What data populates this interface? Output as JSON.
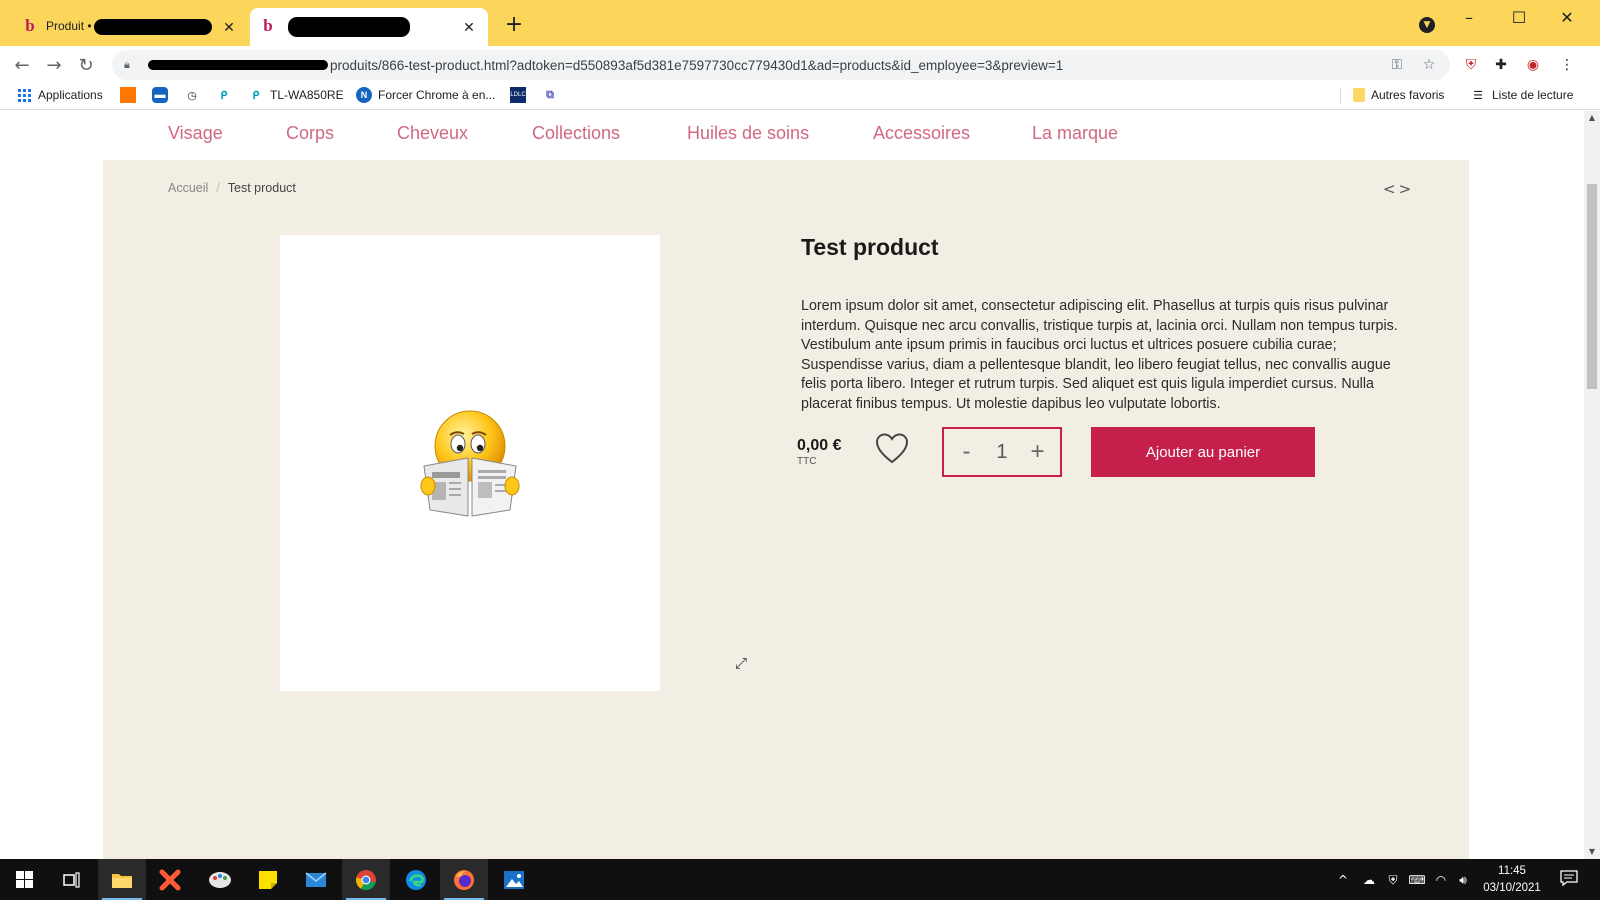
{
  "browser": {
    "tabs": [
      {
        "favicon": "b",
        "title": "Produit •",
        "close": "✕"
      },
      {
        "favicon": "b",
        "title": "",
        "close": "✕"
      }
    ],
    "new_tab": "+",
    "address": {
      "url_visible": "produits/866-test-product.html?adtoken=d550893af5d381e7597730cc779430d1&ad=products&id_employee=3&preview=1"
    },
    "bookmarks": [
      {
        "label": "Applications",
        "icon": "apps-grid-icon"
      },
      {
        "label": "",
        "icon": "orange-icon"
      },
      {
        "label": "",
        "icon": "blue-square-icon"
      },
      {
        "label": "",
        "icon": "clock-icon"
      },
      {
        "label": "",
        "icon": "tplink-icon"
      },
      {
        "label": "TL-WA850RE",
        "icon": "tplink-icon"
      },
      {
        "label": "Forcer Chrome à en...",
        "icon": "n-icon"
      },
      {
        "label": "",
        "icon": "ldlc-icon"
      },
      {
        "label": "",
        "icon": "teams-icon"
      }
    ],
    "other_bookmarks": "Autres favoris",
    "reading_list": "Liste de lecture"
  },
  "site": {
    "nav": [
      "Visage",
      "Corps",
      "Cheveux",
      "Collections",
      "Huiles de soins",
      "Accessoires",
      "La marque"
    ],
    "breadcrumb": {
      "home": "Accueil",
      "separator": "/",
      "current": "Test product"
    },
    "product_nav": "<>",
    "product": {
      "title": "Test product",
      "description": "Lorem ipsum dolor sit amet, consectetur adipiscing elit. Phasellus at turpis quis risus pulvinar interdum. Quisque nec arcu convallis, tristique turpis at, lacinia orci. Nullam non tempus turpis. Vestibulum ante ipsum primis in faucibus orci luctus et ultrices posuere cubilia curae; Suspendisse varius, diam a pellentesque blandit, leo libero feugiat tellus, nec convallis augue felis porta libero. Integer et rutrum turpis. Sed aliquet est quis ligula imperdiet cursus. Nulla placerat finibus tempus. Ut molestie dapibus leo vulputate lobortis.",
      "price": "0,00 €",
      "tax_label": "TTC",
      "quantity": "1",
      "qty_minus": "-",
      "qty_plus": "+",
      "add_to_cart": "Ajouter au panier",
      "image_icon": "reading-newspaper-emoji-icon",
      "expand_icon": "expand-icon"
    },
    "colors": {
      "accent": "#c4204b",
      "nav_text": "#d06880",
      "content_bg": "#f3eee4",
      "browser_frame": "#fcd65a"
    }
  },
  "taskbar": {
    "clock_time": "11:45",
    "clock_date": "03/10/2021"
  }
}
